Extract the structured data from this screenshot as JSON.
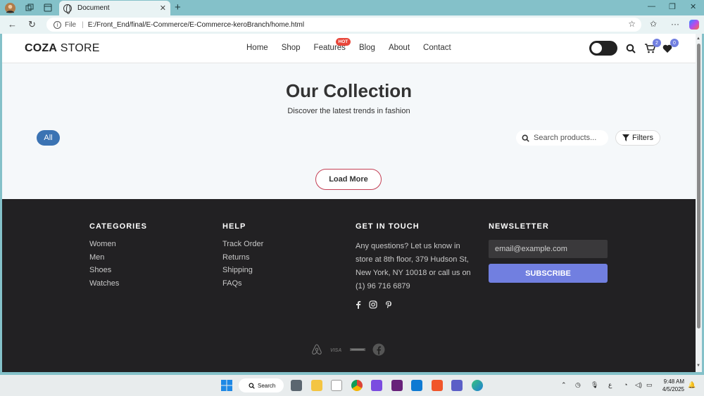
{
  "browser": {
    "tab_title": "Document",
    "tab_close": "✕",
    "new_tab": "+",
    "url_scheme": "File",
    "url": "E:/Front_End/final/E-Commerce/E-Commerce-keroBranch/home.html"
  },
  "site": {
    "logo_bold": "COZA",
    "logo_rest": " STORE",
    "nav": [
      "Home",
      "Shop",
      "Features",
      "Blog",
      "About",
      "Contact"
    ],
    "hot_badge": "HOT",
    "cart_count": "2",
    "wishlist_count": "0"
  },
  "hero": {
    "title": "Our Collection",
    "subtitle": "Discover the latest trends in fashion"
  },
  "filters": {
    "all_chip": "All",
    "search_placeholder": "Search products...",
    "filters_label": "Filters",
    "load_more": "Load More"
  },
  "footer": {
    "categories": {
      "title": "CATEGORIES",
      "items": [
        "Women",
        "Men",
        "Shoes",
        "Watches"
      ]
    },
    "help": {
      "title": "HELP",
      "items": [
        "Track Order",
        "Returns",
        "Shipping",
        "FAQs"
      ]
    },
    "touch": {
      "title": "GET IN TOUCH",
      "text": "Any questions? Let us know in store at 8th floor, 379 Hudson St, New York, NY 10018 or call us on (1) 96 716 6879",
      "socials": [
        "facebook-icon",
        "instagram-icon",
        "pinterest-icon"
      ]
    },
    "newsletter": {
      "title": "NEWSLETTER",
      "placeholder": "email@example.com",
      "button": "SUBSCRIBE"
    },
    "payments": [
      "airbnb-icon",
      "visa-icon",
      "amex-icon",
      "facebook-icon"
    ]
  },
  "taskbar": {
    "search_label": "Search",
    "time": "9:48 AM",
    "date": "4/5/2025",
    "lang": "ع"
  },
  "colors": {
    "accent": "#717fe0",
    "chip": "#3b73b3",
    "footer_bg": "#222123",
    "load_more_border": "#c43f54",
    "hot": "#e8473b"
  }
}
